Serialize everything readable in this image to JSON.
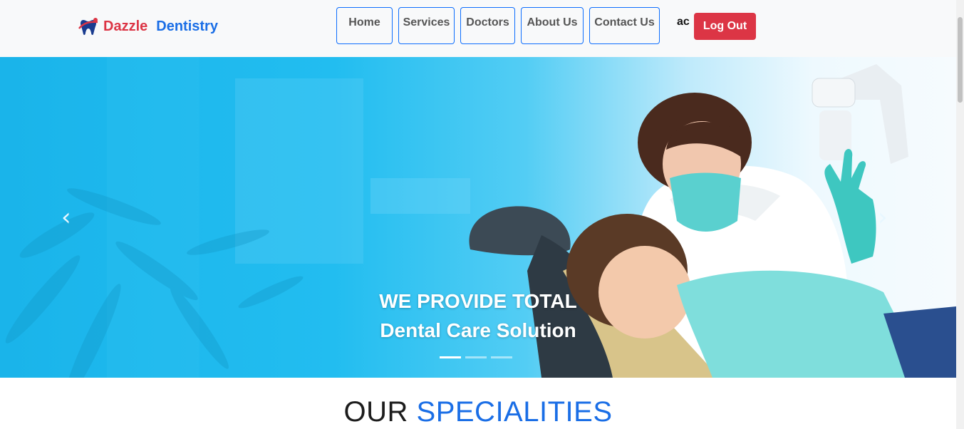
{
  "brand": {
    "word1": "Dazzle",
    "word2": "Dentistry",
    "logo_icon": "tooth-logo-icon"
  },
  "nav": {
    "items": [
      {
        "label": "Home"
      },
      {
        "label": "Services"
      },
      {
        "label": "Doctors"
      },
      {
        "label": "About Us"
      },
      {
        "label": "Contact Us"
      }
    ],
    "user_label": "ac",
    "logout_label": "Log Out"
  },
  "hero": {
    "line1": "WE PROVIDE TOTAL",
    "line2": "Dental Care Solution",
    "prev_icon": "chevron-left-icon",
    "next_icon": "chevron-right-icon",
    "slides": 3,
    "active_slide": 1
  },
  "section": {
    "title_part1": "OUR",
    "title_part2": "SPECIALITIES"
  },
  "colors": {
    "accent_blue": "#1a6ee6",
    "danger_red": "#dc3545",
    "nav_border": "#0d6efd"
  }
}
